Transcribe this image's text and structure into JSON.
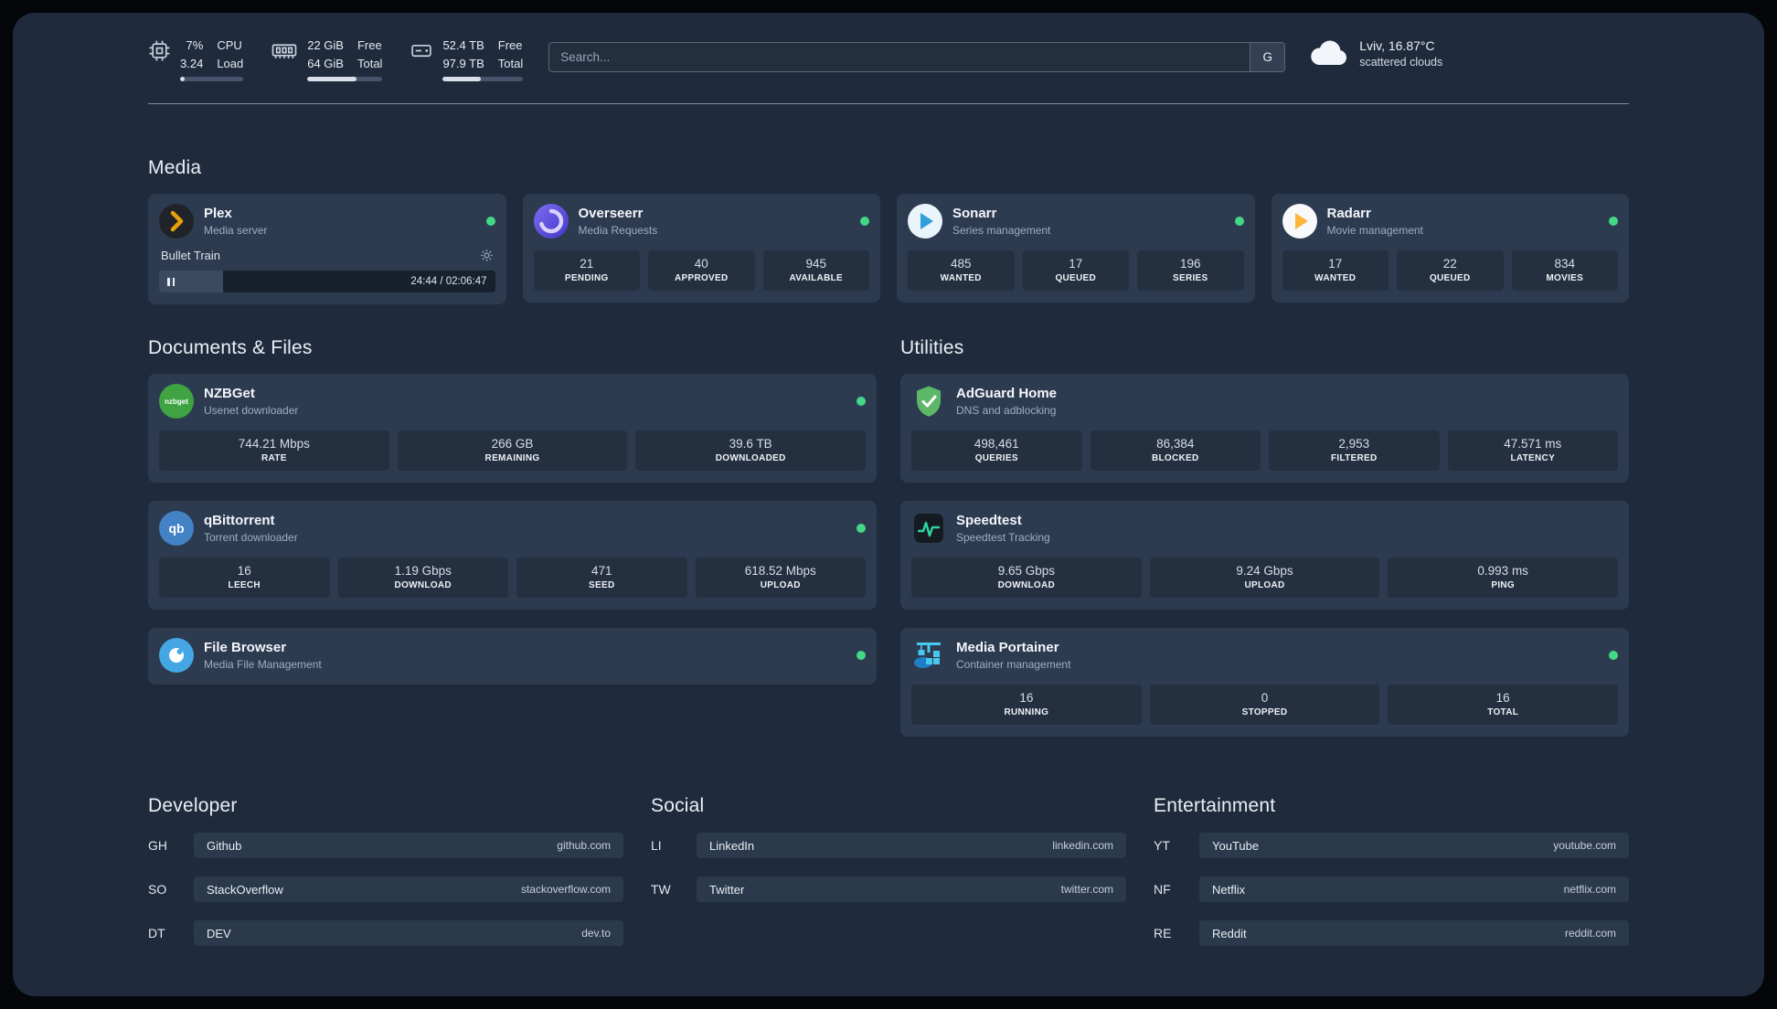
{
  "topbar": {
    "cpu": {
      "icon": "cpu-chip",
      "value1": "7%",
      "value2": "3.24",
      "label1": "CPU",
      "label2": "Load",
      "bar_percent": 7
    },
    "ram": {
      "icon": "memory",
      "value1": "22 GiB",
      "value2": "64 GiB",
      "label1": "Free",
      "label2": "Total",
      "bar_percent": 66
    },
    "disk": {
      "icon": "hard-drive",
      "value1": "52.4 TB",
      "value2": "97.9 TB",
      "label1": "Free",
      "label2": "Total",
      "bar_percent": 47
    },
    "search": {
      "placeholder": "Search...",
      "provider_label": "G"
    },
    "weather": {
      "icon": "cloud",
      "location": "Lviv, 16.87°C",
      "condition": "scattered clouds"
    }
  },
  "colors": {
    "status_online": "#43d787",
    "plex_amber": "#e5a00d",
    "background": "#1f2b3d",
    "card": "#2d3b50"
  },
  "sections": {
    "media": "Media",
    "documents": "Documents & Files",
    "utilities": "Utilities",
    "developer": "Developer",
    "social": "Social",
    "entertainment": "Entertainment"
  },
  "services": {
    "plex": {
      "name": "Plex",
      "desc": "Media server",
      "now_playing": "Bullet Train",
      "time": "24:44 / 02:06:47",
      "progress_percent": 19
    },
    "overseerr": {
      "name": "Overseerr",
      "desc": "Media Requests",
      "stats": [
        {
          "value": "21",
          "label": "PENDING"
        },
        {
          "value": "40",
          "label": "APPROVED"
        },
        {
          "value": "945",
          "label": "AVAILABLE"
        }
      ]
    },
    "sonarr": {
      "name": "Sonarr",
      "desc": "Series management",
      "stats": [
        {
          "value": "485",
          "label": "WANTED"
        },
        {
          "value": "17",
          "label": "QUEUED"
        },
        {
          "value": "196",
          "label": "SERIES"
        }
      ]
    },
    "radarr": {
      "name": "Radarr",
      "desc": "Movie management",
      "stats": [
        {
          "value": "17",
          "label": "WANTED"
        },
        {
          "value": "22",
          "label": "QUEUED"
        },
        {
          "value": "834",
          "label": "MOVIES"
        }
      ]
    },
    "nzbget": {
      "name": "NZBGet",
      "desc": "Usenet downloader",
      "stats": [
        {
          "value": "744.21 Mbps",
          "label": "RATE"
        },
        {
          "value": "266 GB",
          "label": "REMAINING"
        },
        {
          "value": "39.6 TB",
          "label": "DOWNLOADED"
        }
      ]
    },
    "qbittorrent": {
      "name": "qBittorrent",
      "desc": "Torrent downloader",
      "stats": [
        {
          "value": "16",
          "label": "LEECH"
        },
        {
          "value": "1.19 Gbps",
          "label": "DOWNLOAD"
        },
        {
          "value": "471",
          "label": "SEED"
        },
        {
          "value": "618.52 Mbps",
          "label": "UPLOAD"
        }
      ]
    },
    "filebrowser": {
      "name": "File Browser",
      "desc": "Media File Management"
    },
    "adguard": {
      "name": "AdGuard Home",
      "desc": "DNS and adblocking",
      "stats": [
        {
          "value": "498,461",
          "label": "QUERIES"
        },
        {
          "value": "86,384",
          "label": "BLOCKED"
        },
        {
          "value": "2,953",
          "label": "FILTERED"
        },
        {
          "value": "47.571 ms",
          "label": "LATENCY"
        }
      ]
    },
    "speedtest": {
      "name": "Speedtest",
      "desc": "Speedtest Tracking",
      "stats": [
        {
          "value": "9.65 Gbps",
          "label": "DOWNLOAD"
        },
        {
          "value": "9.24 Gbps",
          "label": "UPLOAD"
        },
        {
          "value": "0.993 ms",
          "label": "PING"
        }
      ]
    },
    "portainer": {
      "name": "Media Portainer",
      "desc": "Container management",
      "stats": [
        {
          "value": "16",
          "label": "RUNNING"
        },
        {
          "value": "0",
          "label": "STOPPED"
        },
        {
          "value": "16",
          "label": "TOTAL"
        }
      ]
    }
  },
  "bookmarks": {
    "developer": [
      {
        "abbr": "GH",
        "name": "Github",
        "url": "github.com"
      },
      {
        "abbr": "SO",
        "name": "StackOverflow",
        "url": "stackoverflow.com"
      },
      {
        "abbr": "DT",
        "name": "DEV",
        "url": "dev.to"
      }
    ],
    "social": [
      {
        "abbr": "LI",
        "name": "LinkedIn",
        "url": "linkedin.com"
      },
      {
        "abbr": "TW",
        "name": "Twitter",
        "url": "twitter.com"
      }
    ],
    "entertainment": [
      {
        "abbr": "YT",
        "name": "YouTube",
        "url": "youtube.com"
      },
      {
        "abbr": "NF",
        "name": "Netflix",
        "url": "netflix.com"
      },
      {
        "abbr": "RE",
        "name": "Reddit",
        "url": "reddit.com"
      }
    ]
  }
}
